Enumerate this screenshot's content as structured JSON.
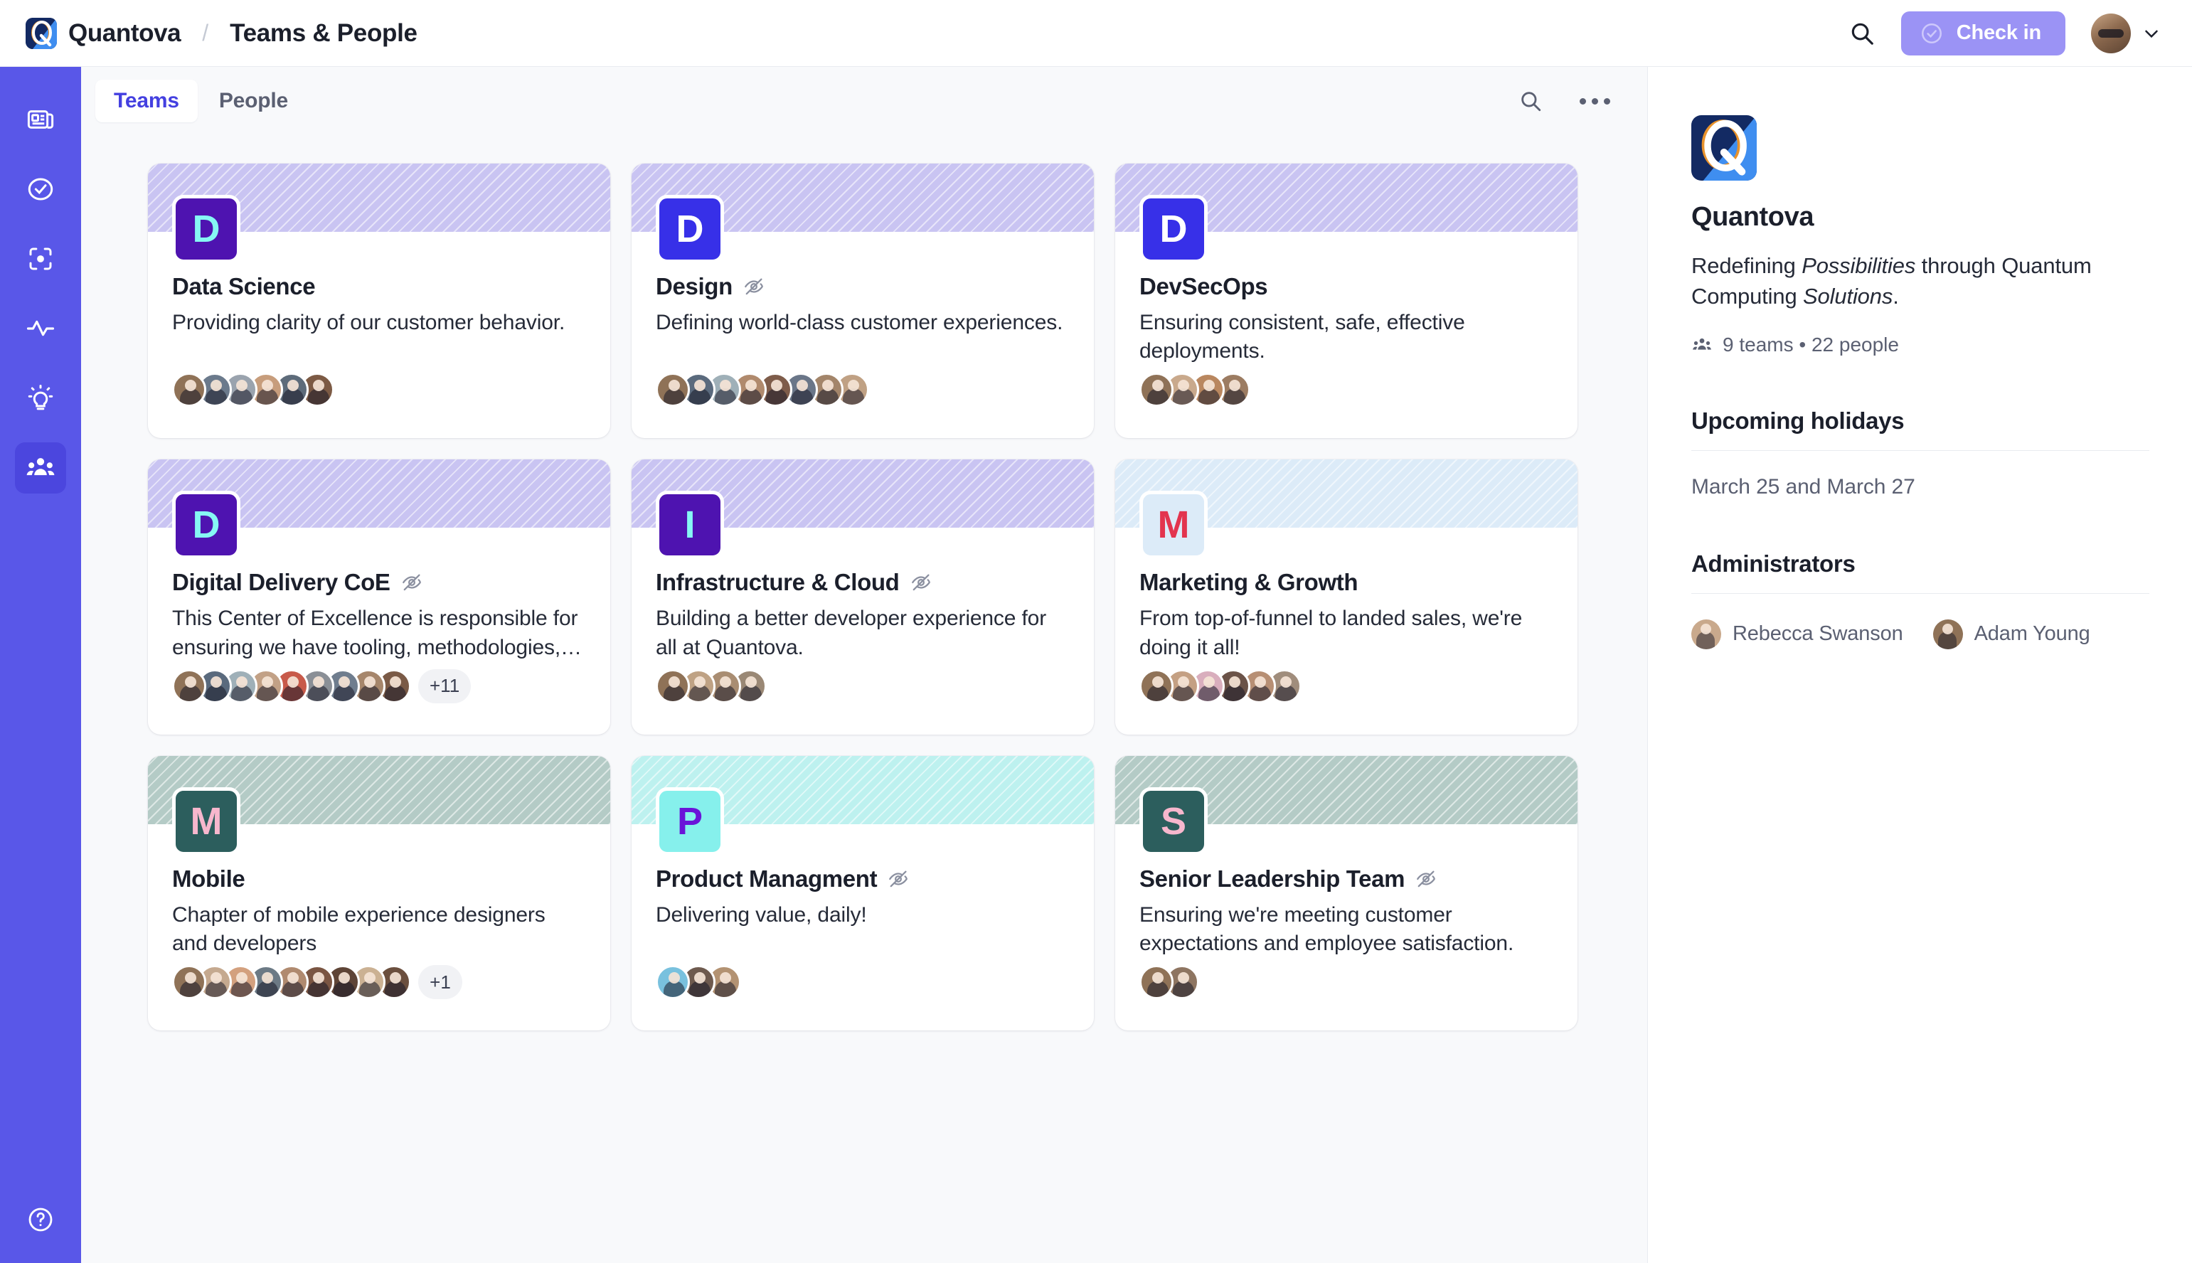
{
  "header": {
    "brand": "Quantova",
    "separator": "/",
    "page_title": "Teams & People",
    "search_icon": "search-icon",
    "checkin_label": "Check in",
    "accent": "#5957e8",
    "checkin_bg": "#9b93f5"
  },
  "sidebar": {
    "items": [
      {
        "icon": "news-feed-icon",
        "active": false
      },
      {
        "icon": "check-circle-icon",
        "active": false
      },
      {
        "icon": "target-focus-icon",
        "active": false
      },
      {
        "icon": "activity-pulse-icon",
        "active": false
      },
      {
        "icon": "lightbulb-icon",
        "active": false
      },
      {
        "icon": "people-group-icon",
        "active": true
      }
    ],
    "help_icon": "help-circle-icon"
  },
  "toolbar": {
    "tabs": [
      {
        "label": "Teams",
        "active": true
      },
      {
        "label": "People",
        "active": false
      }
    ],
    "search_icon": "search-icon",
    "more_icon": "more-options-icon"
  },
  "teams": [
    {
      "initial": "D",
      "name": "Data Science",
      "description": "Providing clarity of our customer behavior.",
      "private": false,
      "banner_color": "#c9c4f2",
      "tile_bg": "#4e13b0",
      "tile_fg": "#86f7f4",
      "member_count": 6,
      "overflow": null,
      "avatars": [
        "#8f7257",
        "#6b7a8c",
        "#9aa3ae",
        "#c79d7c",
        "#5d6b7a",
        "#7c5a44"
      ]
    },
    {
      "initial": "D",
      "name": "Design",
      "description": "Defining world-class customer experiences.",
      "private": true,
      "banner_color": "#c9c4f2",
      "tile_bg": "#3730e8",
      "tile_fg": "#ffffff",
      "member_count": 8,
      "overflow": null,
      "avatars": [
        "#8f7257",
        "#5a6a7d",
        "#9fb0b8",
        "#b08a6d",
        "#7e5c4a",
        "#6a7688",
        "#a3856a",
        "#c0a184"
      ]
    },
    {
      "initial": "D",
      "name": "DevSecOps",
      "description": "Ensuring consistent, safe, effective deployments.",
      "private": false,
      "banner_color": "#c9c4f2",
      "tile_bg": "#3730e8",
      "tile_fg": "#ffffff",
      "member_count": 4,
      "overflow": null,
      "avatars": [
        "#8f7257",
        "#c9a98c",
        "#b9875f",
        "#9c7c62"
      ]
    },
    {
      "initial": "D",
      "name": "Digital Delivery CoE",
      "description": "This Center of Excellence is responsible for ensuring we have tooling, methodologies,…",
      "private": true,
      "banner_color": "#c9c4f2",
      "tile_bg": "#4e13b0",
      "tile_fg": "#86f7f4",
      "member_count": 9,
      "overflow": "+11",
      "avatars": [
        "#8f7257",
        "#5a6a7d",
        "#9fb0b8",
        "#c2a186",
        "#c85a4a",
        "#8a8f96",
        "#6f7d8e",
        "#a6866b",
        "#7a5a46"
      ]
    },
    {
      "initial": "I",
      "name": "Infrastructure & Cloud",
      "description": "Building a better developer experience for all at Quantova.",
      "private": true,
      "banner_color": "#c9c4f2",
      "tile_bg": "#4e13b0",
      "tile_fg": "#86f7f4",
      "member_count": 4,
      "overflow": null,
      "avatars": [
        "#8f7257",
        "#bfa284",
        "#a98d72",
        "#9a8875"
      ]
    },
    {
      "initial": "M",
      "name": "Marketing & Growth",
      "description": "From top-of-funnel to landed sales, we're doing it all!",
      "private": false,
      "banner_color": "#dcebf8",
      "tile_bg": "#dcebf8",
      "tile_fg": "#e3344e",
      "member_count": 6,
      "overflow": null,
      "avatars": [
        "#8f7257",
        "#c4a083",
        "#d9aebd",
        "#6b5348",
        "#b78f74",
        "#a08d7c"
      ]
    },
    {
      "initial": "M",
      "name": "Mobile",
      "description": "Chapter of mobile experience designers and developers",
      "private": false,
      "banner_color": "#b4cbc6",
      "tile_bg": "#2c5e5d",
      "tile_fg": "#f7b7cd",
      "member_count": 9,
      "overflow": "+1",
      "avatars": [
        "#8f7257",
        "#c5a98f",
        "#d3a07e",
        "#6c7a85",
        "#b08a6f",
        "#7a5542",
        "#5e4436",
        "#cbb193",
        "#6b4f3e"
      ]
    },
    {
      "initial": "P",
      "name": "Product Managment",
      "description": "Delivering value, daily!",
      "private": true,
      "banner_color": "#bdf1ef",
      "tile_bg": "#86f0ec",
      "tile_fg": "#6a14d8",
      "member_count": 3,
      "overflow": null,
      "avatars": [
        "#79c1de",
        "#6e5a4e",
        "#b39272"
      ]
    },
    {
      "initial": "S",
      "name": "Senior Leadership Team",
      "description": "Ensuring we're meeting customer expectations and employee satisfaction.",
      "private": true,
      "banner_color": "#b4cbc6",
      "tile_bg": "#2c5e5d",
      "tile_fg": "#f7b7cd",
      "member_count": 2,
      "overflow": null,
      "avatars": [
        "#8f7257",
        "#8e7561"
      ]
    }
  ],
  "right_panel": {
    "org_logo_icon": "quantova-logo-icon",
    "org_name": "Quantova",
    "tagline_parts": [
      {
        "text": "Redefining ",
        "italic": false
      },
      {
        "text": "Possibilities",
        "italic": true
      },
      {
        "text": " through Quantum Computing ",
        "italic": false
      },
      {
        "text": "Solutions",
        "italic": true
      },
      {
        "text": ".",
        "italic": false
      }
    ],
    "stats_icon": "people-group-icon",
    "stats": "9 teams • 22 people",
    "holidays_heading": "Upcoming holidays",
    "holidays_value": "March 25 and March 27",
    "administrators_heading": "Administrators",
    "administrators": [
      {
        "name": "Rebecca Swanson",
        "avatar_color": "#c9a98c"
      },
      {
        "name": "Adam Young",
        "avatar_color": "#8f7257"
      }
    ]
  }
}
